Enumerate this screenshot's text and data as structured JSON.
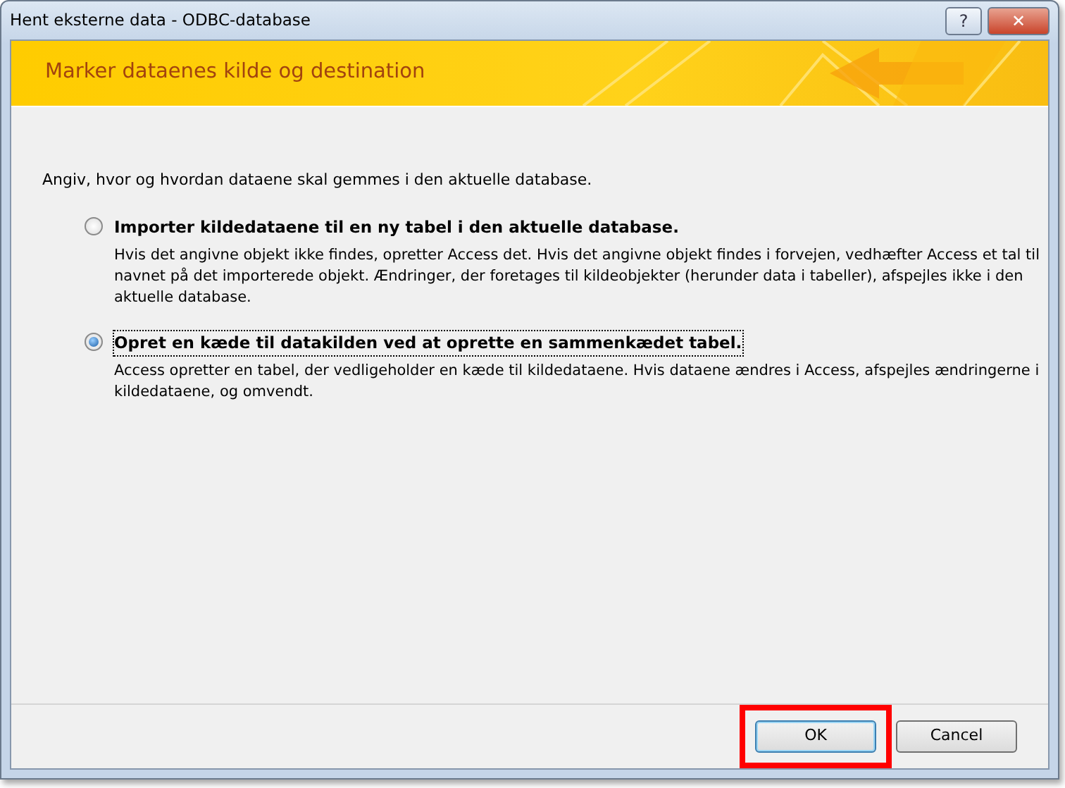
{
  "window": {
    "title": "Hent eksterne data - ODBC-database",
    "controls": [
      "?",
      "✕"
    ]
  },
  "banner": {
    "title": "Marker dataenes kilde og destination"
  },
  "intro": "Angiv, hvor og hvordan dataene skal gemmes i den aktuelle database.",
  "options": [
    {
      "label": "Importer kildedataene til en ny tabel i den aktuelle database.",
      "description": "Hvis det angivne objekt ikke findes, opretter Access det. Hvis det angivne objekt findes i forvejen, vedhæfter Access et tal til navnet på det importerede objekt. Ændringer, der foretages til kildeobjekter (herunder data i tabeller), afspejles ikke i den aktuelle database.",
      "selected": false
    },
    {
      "label": "Opret en kæde til datakilden ved at oprette en sammenkædet tabel.",
      "description": "Access opretter en tabel, der vedligeholder en kæde til kildedataene. Hvis dataene ændres i Access, afspejles ændringerne i kildedataene, og omvendt.",
      "selected": true
    }
  ],
  "buttons": [
    {
      "label": "OK",
      "highlighted": true
    },
    {
      "label": "Cancel",
      "highlighted": false
    }
  ]
}
